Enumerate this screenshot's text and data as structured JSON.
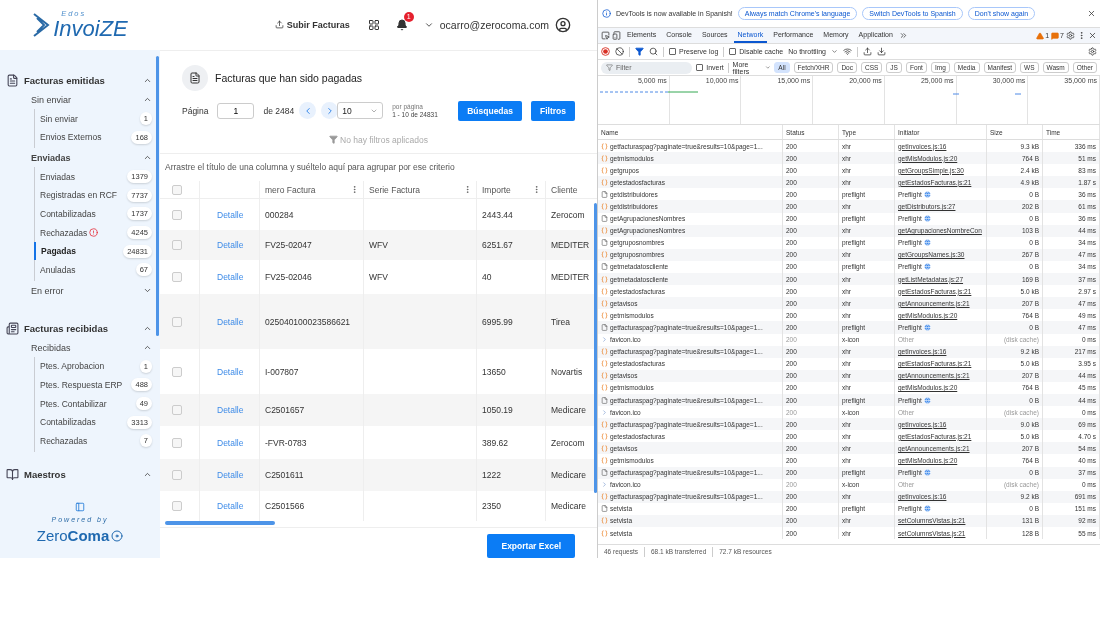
{
  "sidebar": {
    "logo": {
      "small": "Edos",
      "name": "Invoi**ZE**"
    },
    "sections": [
      {
        "title": "Facturas emitidas",
        "expanded": true,
        "groups": [
          {
            "title": "Sin enviar",
            "expanded": true,
            "items": [
              {
                "label": "Sin enviar",
                "count": "1",
                "selected": false,
                "alert": false
              },
              {
                "label": "Envios Externos",
                "count": "168",
                "selected": false,
                "alert": false
              }
            ]
          },
          {
            "title": "Enviadas",
            "expanded": true,
            "items": [
              {
                "label": "Enviadas",
                "count": "1379",
                "selected": false,
                "alert": false
              },
              {
                "label": "Registradas en RCF",
                "count": "7737",
                "selected": false,
                "alert": false
              },
              {
                "label": "Contabilizadas",
                "count": "1737",
                "selected": false,
                "alert": false
              },
              {
                "label": "Rechazadas",
                "count": "4245",
                "selected": false,
                "alert": true
              },
              {
                "label": "Pagadas",
                "count": "24831",
                "selected": true,
                "alert": false
              },
              {
                "label": "Anuladas",
                "count": "67",
                "selected": false,
                "alert": false
              }
            ]
          },
          {
            "title": "En error",
            "expanded": false
          }
        ]
      },
      {
        "title": "Facturas recibidas",
        "expanded": true,
        "groups": [
          {
            "title": "Recibidas",
            "expanded": true,
            "items": [
              {
                "label": "Ptes. Aprobacion",
                "count": "1",
                "selected": false,
                "alert": false
              },
              {
                "label": "Ptes. Respuesta ERP",
                "count": "488",
                "selected": false,
                "alert": false
              },
              {
                "label": "Ptes. Contabilizar",
                "count": "49",
                "selected": false,
                "alert": false
              },
              {
                "label": "Contabilizadas",
                "count": "3313",
                "selected": false,
                "alert": false
              },
              {
                "label": "Rechazadas",
                "count": "7",
                "selected": false,
                "alert": false
              }
            ]
          }
        ]
      },
      {
        "title": "Maestros",
        "expanded": true
      }
    ],
    "footer": {
      "powered": "Powered by",
      "brand": "Zero**Coma**"
    }
  },
  "header": {
    "upload_button": "Subir Facturas",
    "notifications": "1",
    "user": "ocarro@zerocoma.com"
  },
  "page": {
    "title": "Facturas que han sido pagadas",
    "pagination": {
      "label": "Página",
      "page": "1",
      "of": "de 2484",
      "per_page": "10",
      "per_page_label": "por página",
      "range": "1 - 10 de 24831"
    },
    "buttons": [
      "Búsquedas",
      "Filtros"
    ],
    "filter_status": "No hay filtros aplicados",
    "group_hint": "Arrastre el título de una columna y suéltelo aquí para agrupar por ese criterio",
    "table": {
      "header_checked": false,
      "columns": [
        "mero Factura",
        "Serie Factura",
        "Importe",
        "Cliente"
      ],
      "rows": [
        {
          "checked": false,
          "link": "Detalle",
          "numero": "000284",
          "importe": "2443.44",
          "cliente": "Zerocom"
        },
        {
          "checked": false,
          "link": "Detalle",
          "numero": "FV25-02047",
          "serie": "WFV",
          "importe": "6251.67",
          "cliente": "MEDITER"
        },
        {
          "checked": false,
          "link": "Detalle",
          "numero": "FV25-02046",
          "serie": "WFV",
          "importe": "40",
          "cliente": "MEDITER"
        },
        {
          "checked": false,
          "link": "Detalle",
          "numero": "025040100023586621",
          "importe": "6995.99",
          "cliente": "Tirea"
        },
        {
          "checked": false,
          "link": "Detalle",
          "numero": "I-007807",
          "importe": "13650",
          "cliente": "Novartis"
        },
        {
          "checked": false,
          "link": "Detalle",
          "numero": "C2501657",
          "importe": "1050.19",
          "cliente": "Medicare"
        },
        {
          "checked": false,
          "link": "Detalle",
          "numero": "-FVR-0783",
          "importe": "389.62",
          "cliente": "Zerocom"
        },
        {
          "checked": false,
          "link": "Detalle",
          "numero": "C2501611",
          "importe": "1222",
          "cliente": "Medicare"
        },
        {
          "checked": false,
          "link": "Detalle",
          "numero": "C2501566",
          "importe": "2350",
          "cliente": "Medicare"
        }
      ]
    },
    "export_button": "Exportar Excel"
  },
  "devtools": {
    "infobar": {
      "message": "DevTools is now available in Spanish!",
      "buttons": [
        "Always match Chrome's language",
        "Switch DevTools to Spanish",
        "Don't show again"
      ]
    },
    "tabs": [
      {
        "label": "Elements",
        "selected": false
      },
      {
        "label": "Console",
        "selected": false
      },
      {
        "label": "Sources",
        "selected": false
      },
      {
        "label": "Network",
        "selected": true
      },
      {
        "label": "Performance",
        "selected": false
      },
      {
        "label": "Memory",
        "selected": false
      },
      {
        "label": "Application",
        "selected": false
      }
    ],
    "warnings": "1",
    "errors": "7",
    "toolbar": {
      "preserve_log": {
        "label": "Preserve log",
        "checked": false
      },
      "disable_cache": {
        "label": "Disable cache",
        "checked": false
      },
      "throttling": "No throttling"
    },
    "filter": {
      "placeholder": "Filter",
      "invert": {
        "label": "Invert",
        "checked": false
      },
      "more_filters": "More filters",
      "chips": [
        {
          "label": "All",
          "selected": true
        },
        {
          "label": "Fetch/XHR",
          "selected": false
        },
        {
          "label": "Doc",
          "selected": false
        },
        {
          "label": "CSS",
          "selected": false
        },
        {
          "label": "JS",
          "selected": false
        },
        {
          "label": "Font",
          "selected": false
        },
        {
          "label": "Img",
          "selected": false
        },
        {
          "label": "Media",
          "selected": false
        },
        {
          "label": "Manifest",
          "selected": false
        },
        {
          "label": "WS",
          "selected": false
        },
        {
          "label": "Wasm",
          "selected": false
        },
        {
          "label": "Other",
          "selected": false
        }
      ]
    },
    "overview": {
      "ticks": [
        "5,000 ms",
        "10,000 ms",
        "15,000 ms",
        "20,000 ms",
        "25,000 ms",
        "30,000 ms",
        "35,000 ms"
      ]
    },
    "network": {
      "columns": [
        "Name",
        "Status",
        "Type",
        "Initiator",
        "Size",
        "Time"
      ],
      "rows": [
        {
          "kind": "xhr",
          "name": "getfacturaspag?paginate=true&results=10&page=1...",
          "status": "200",
          "type": "xhr",
          "initiator": "getInvoices.js:16",
          "size": "9.3 kB",
          "time": "336 ms"
        },
        {
          "kind": "xhr",
          "name": "getmismodulos",
          "status": "200",
          "type": "xhr",
          "initiator": "getMisModulos.js:20",
          "size": "764 B",
          "time": "51 ms"
        },
        {
          "kind": "xhr",
          "name": "getgrupos",
          "status": "200",
          "type": "xhr",
          "initiator": "getGroupsSimple.js:30",
          "size": "2.4 kB",
          "time": "83 ms"
        },
        {
          "kind": "xhr",
          "name": "getestadosfacturas",
          "status": "200",
          "type": "xhr",
          "initiator": "getEstadosFacturas.js:21",
          "size": "4.9 kB",
          "time": "1.87 s"
        },
        {
          "kind": "preflight",
          "name": "getdistribuidores",
          "status": "200",
          "type": "preflight",
          "initiator": "Preflight",
          "size": "0 B",
          "time": "36 ms"
        },
        {
          "kind": "xhr",
          "name": "getdistribuidores",
          "status": "200",
          "type": "xhr",
          "initiator": "getDistributors.js:27",
          "size": "202 B",
          "time": "61 ms"
        },
        {
          "kind": "preflight",
          "name": "getAgrupacionesNombres",
          "status": "200",
          "type": "preflight",
          "initiator": "Preflight",
          "size": "0 B",
          "time": "36 ms"
        },
        {
          "kind": "xhr",
          "name": "getAgrupacionesNombres",
          "status": "200",
          "type": "xhr",
          "initiator": "getAgrupacionesNombreCon",
          "size": "103 B",
          "time": "44 ms"
        },
        {
          "kind": "preflight",
          "name": "getgruposnombres",
          "status": "200",
          "type": "preflight",
          "initiator": "Preflight",
          "size": "0 B",
          "time": "34 ms"
        },
        {
          "kind": "xhr",
          "name": "getgruposnombres",
          "status": "200",
          "type": "xhr",
          "initiator": "getGroupsNames.js:30",
          "size": "267 B",
          "time": "47 ms"
        },
        {
          "kind": "preflight",
          "name": "getmetadatoscliente",
          "status": "200",
          "type": "preflight",
          "initiator": "Preflight",
          "size": "0 B",
          "time": "34 ms"
        },
        {
          "kind": "xhr",
          "name": "getmetadatoscliente",
          "status": "200",
          "type": "xhr",
          "initiator": "getListMetadatas.js:27",
          "size": "169 B",
          "time": "37 ms"
        },
        {
          "kind": "xhr",
          "name": "getestadosfacturas",
          "status": "200",
          "type": "xhr",
          "initiator": "getEstadosFacturas.js:21",
          "size": "5.0 kB",
          "time": "2.97 s"
        },
        {
          "kind": "xhr",
          "name": "getavisos",
          "status": "200",
          "type": "xhr",
          "initiator": "getAnnouncements.js:21",
          "size": "207 B",
          "time": "47 ms"
        },
        {
          "kind": "xhr",
          "name": "getmismodulos",
          "status": "200",
          "type": "xhr",
          "initiator": "getMisModulos.js:20",
          "size": "764 B",
          "time": "49 ms"
        },
        {
          "kind": "preflight",
          "name": "getfacturaspag?paginate=true&results=10&page=1...",
          "status": "200",
          "type": "preflight",
          "initiator": "Preflight",
          "size": "0 B",
          "time": "47 ms"
        },
        {
          "kind": "cached",
          "name": "favicon.ico",
          "status": "200",
          "type": "x-icon",
          "initiator": "Other",
          "size": "(disk cache)",
          "time": "0 ms"
        },
        {
          "kind": "xhr",
          "name": "getfacturaspag?paginate=true&results=10&page=1...",
          "status": "200",
          "type": "xhr",
          "initiator": "getInvoices.js:16",
          "size": "9.2 kB",
          "time": "217 ms"
        },
        {
          "kind": "xhr",
          "name": "getestadosfacturas",
          "status": "200",
          "type": "xhr",
          "initiator": "getEstadosFacturas.js:21",
          "size": "5.0 kB",
          "time": "3.95 s"
        },
        {
          "kind": "xhr",
          "name": "getavisos",
          "status": "200",
          "type": "xhr",
          "initiator": "getAnnouncements.js:21",
          "size": "207 B",
          "time": "44 ms"
        },
        {
          "kind": "xhr",
          "name": "getmismodulos",
          "status": "200",
          "type": "xhr",
          "initiator": "getMisModulos.js:20",
          "size": "764 B",
          "time": "45 ms"
        },
        {
          "kind": "preflight",
          "name": "getfacturaspag?paginate=true&results=10&page=1...",
          "status": "200",
          "type": "preflight",
          "initiator": "Preflight",
          "size": "0 B",
          "time": "44 ms"
        },
        {
          "kind": "cached",
          "name": "favicon.ico",
          "status": "200",
          "type": "x-icon",
          "initiator": "Other",
          "size": "(disk cache)",
          "time": "0 ms"
        },
        {
          "kind": "xhr",
          "name": "getfacturaspag?paginate=true&results=10&page=1...",
          "status": "200",
          "type": "xhr",
          "initiator": "getInvoices.js:16",
          "size": "9.0 kB",
          "time": "69 ms"
        },
        {
          "kind": "xhr",
          "name": "getestadosfacturas",
          "status": "200",
          "type": "xhr",
          "initiator": "getEstadosFacturas.js:21",
          "size": "5.0 kB",
          "time": "4.70 s"
        },
        {
          "kind": "xhr",
          "name": "getavisos",
          "status": "200",
          "type": "xhr",
          "initiator": "getAnnouncements.js:21",
          "size": "207 B",
          "time": "54 ms"
        },
        {
          "kind": "xhr",
          "name": "getmismodulos",
          "status": "200",
          "type": "xhr",
          "initiator": "getMisModulos.js:20",
          "size": "764 B",
          "time": "40 ms"
        },
        {
          "kind": "preflight",
          "name": "getfacturaspag?paginate=true&results=10&page=1...",
          "status": "200",
          "type": "preflight",
          "initiator": "Preflight",
          "size": "0 B",
          "time": "37 ms"
        },
        {
          "kind": "cached",
          "name": "favicon.ico",
          "status": "200",
          "type": "x-icon",
          "initiator": "Other",
          "size": "(disk cache)",
          "time": "0 ms"
        },
        {
          "kind": "xhr",
          "name": "getfacturaspag?paginate=true&results=10&page=1...",
          "status": "200",
          "type": "xhr",
          "initiator": "getInvoices.js:16",
          "size": "9.2 kB",
          "time": "691 ms"
        },
        {
          "kind": "preflight",
          "name": "setvista",
          "status": "200",
          "type": "preflight",
          "initiator": "Preflight",
          "size": "0 B",
          "time": "151 ms"
        },
        {
          "kind": "xhr",
          "name": "setvista",
          "status": "200",
          "type": "xhr",
          "initiator": "setColumnsVistas.js:21",
          "size": "131 B",
          "time": "92 ms"
        },
        {
          "kind": "xhr",
          "name": "setvista",
          "status": "200",
          "type": "xhr",
          "initiator": "setColumnsVistas.js:21",
          "size": "128 B",
          "time": "55 ms"
        }
      ]
    },
    "status_bar": [
      "46 requests",
      "68.1 kB transferred",
      "72.7 kB resources"
    ]
  }
}
